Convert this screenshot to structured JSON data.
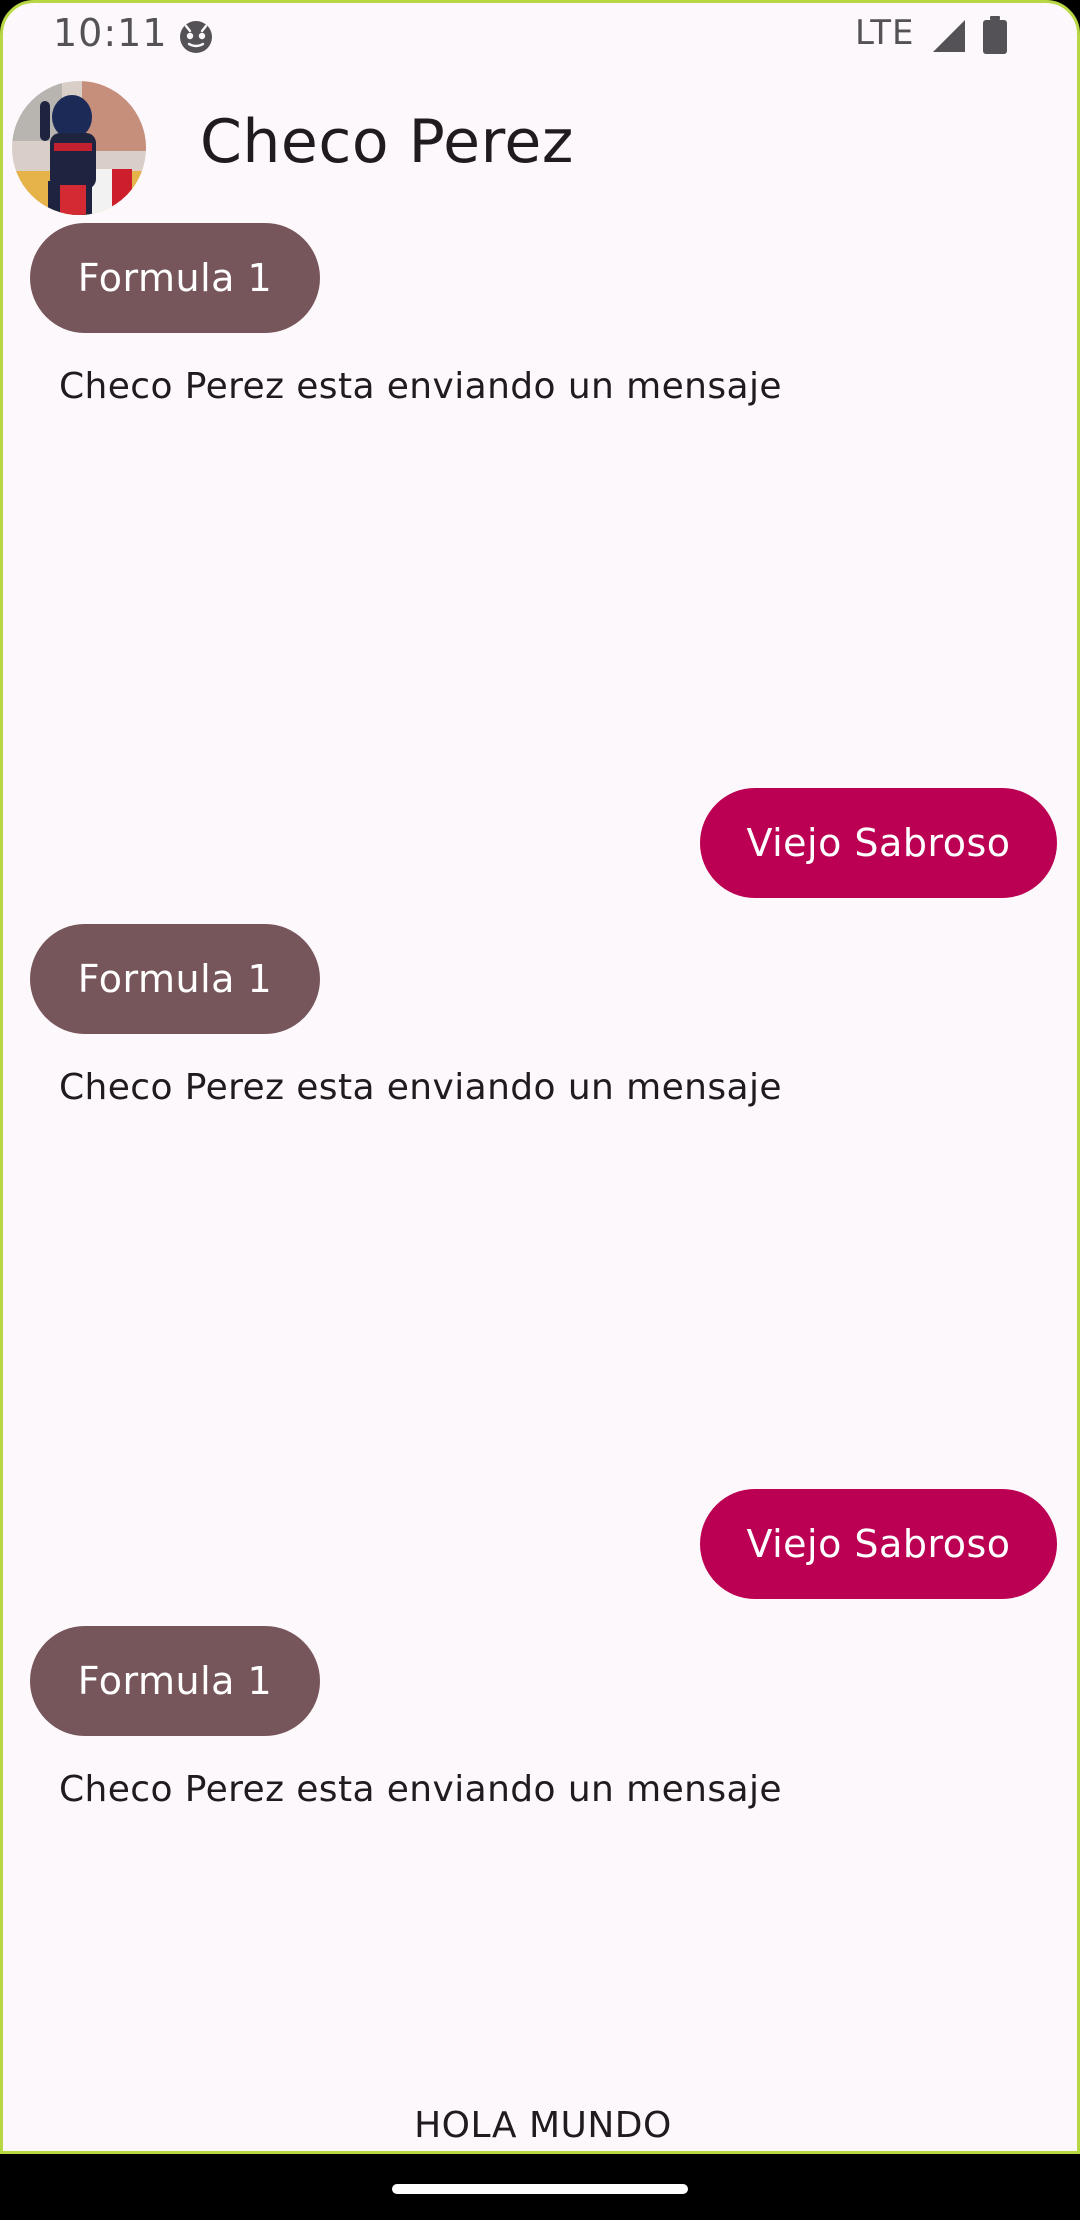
{
  "status_bar": {
    "time": "10:11",
    "network": "LTE",
    "notification_icon": "android-debug-icon",
    "signal_icon": "cell-signal-icon",
    "battery_icon": "battery-icon"
  },
  "header": {
    "contact_name": "Checo Perez",
    "avatar_icon": "contact-avatar-photo"
  },
  "messages": [
    {
      "type": "received",
      "label": "Formula 1",
      "status": "Checo Perez esta enviando un mensaje"
    },
    {
      "type": "sent",
      "label": "Viejo Sabroso"
    },
    {
      "type": "received",
      "label": "Formula 1",
      "status": "Checo Perez esta enviando un mensaje"
    },
    {
      "type": "sent",
      "label": "Viejo Sabroso"
    },
    {
      "type": "received",
      "label": "Formula 1",
      "status": "Checo Perez esta enviando un mensaje"
    }
  ],
  "footer": {
    "text": "HOLA MUNDO"
  },
  "colors": {
    "background": "#fdf8fb",
    "received_bubble": "#77565b",
    "sent_bubble": "#bb0054",
    "frame_border": "#b7d842",
    "text": "#1f1b1e"
  }
}
